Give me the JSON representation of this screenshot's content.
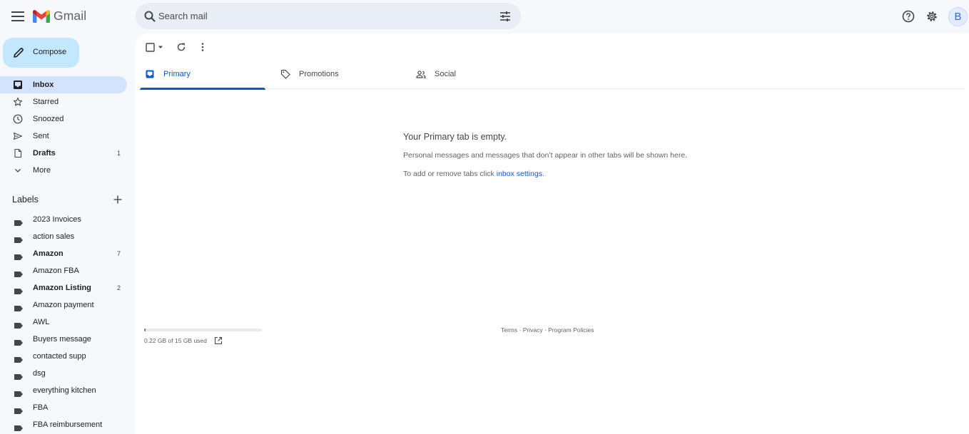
{
  "app": {
    "logo_text": "Gmail"
  },
  "search": {
    "placeholder": "Search mail"
  },
  "account": {
    "avatar_initial": "B"
  },
  "compose": {
    "label": "Compose"
  },
  "nav": {
    "items": [
      {
        "label": "Inbox",
        "icon": "inbox-icon",
        "count": ""
      },
      {
        "label": "Starred",
        "icon": "star-icon",
        "count": ""
      },
      {
        "label": "Snoozed",
        "icon": "clock-icon",
        "count": ""
      },
      {
        "label": "Sent",
        "icon": "send-icon",
        "count": ""
      },
      {
        "label": "Drafts",
        "icon": "draft-icon",
        "count": "1"
      },
      {
        "label": "More",
        "icon": "chevron-down-icon",
        "count": ""
      }
    ]
  },
  "labels": {
    "heading": "Labels",
    "items": [
      {
        "label": "2023 Invoices",
        "count": ""
      },
      {
        "label": "action sales",
        "count": ""
      },
      {
        "label": "Amazon",
        "count": "7"
      },
      {
        "label": "Amazon FBA",
        "count": ""
      },
      {
        "label": "Amazon Listing",
        "count": "2"
      },
      {
        "label": "Amazon payment",
        "count": ""
      },
      {
        "label": "AWL",
        "count": ""
      },
      {
        "label": "Buyers message",
        "count": ""
      },
      {
        "label": "contacted supp",
        "count": ""
      },
      {
        "label": "dsg",
        "count": ""
      },
      {
        "label": "everything kitchen",
        "count": ""
      },
      {
        "label": "FBA",
        "count": ""
      },
      {
        "label": "FBA reimbursement",
        "count": ""
      }
    ]
  },
  "tabs": [
    {
      "label": "Primary",
      "icon": "inbox-tab-icon"
    },
    {
      "label": "Promotions",
      "icon": "tag-icon"
    },
    {
      "label": "Social",
      "icon": "people-icon"
    }
  ],
  "empty_state": {
    "title": "Your Primary tab is empty.",
    "subtitle": "Personal messages and messages that don’t appear in other tabs will be shown here.",
    "tip_prefix": "To add or remove tabs click ",
    "tip_link": "inbox settings",
    "tip_suffix": "."
  },
  "storage": {
    "text": "0.22 GB of 15 GB used",
    "used_fraction": 0.015
  },
  "footer": {
    "terms": "Terms",
    "sep1": " · ",
    "privacy": "Privacy",
    "sep2": " · ",
    "policies": "Program Policies"
  },
  "colors": {
    "accent": "#0b57d0",
    "compose_bg": "#c2e7ff",
    "active_nav": "#d3e3fd",
    "app_bg": "#f6f8fc"
  }
}
